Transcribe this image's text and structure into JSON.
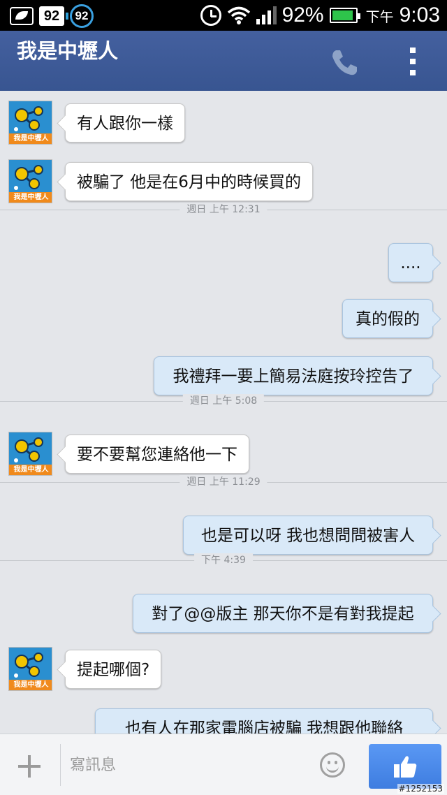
{
  "status_bar": {
    "notif_badge": "92",
    "circle_badge": "92",
    "battery_percent": "92%",
    "battery_level": 0.92,
    "ampm": "下午",
    "time": "9:03",
    "icons": [
      "leaf-notification-icon",
      "alarm-icon",
      "wifi-icon",
      "signal-icon",
      "battery-icon"
    ]
  },
  "header": {
    "title": "我是中壢人",
    "icons": [
      "phone-icon",
      "overflow-menu-icon"
    ],
    "color": "#3b5998"
  },
  "avatar_brand": "我是中壢人",
  "messages": [
    {
      "side": "in",
      "text": "有人跟你一樣"
    },
    {
      "side": "in",
      "text": "被騙了  他是在6月中的時候買的"
    },
    {
      "side": "divider",
      "text": "週日 上午 12:31"
    },
    {
      "side": "out",
      "text": "...."
    },
    {
      "side": "out",
      "text": "真的假的"
    },
    {
      "side": "out",
      "text": "我禮拜一要上簡易法庭按玲控告了"
    },
    {
      "side": "divider",
      "text": "週日 上午 5:08"
    },
    {
      "side": "in",
      "text": "要不要幫您連絡他一下"
    },
    {
      "side": "divider",
      "text": "週日 上午 11:29"
    },
    {
      "side": "out",
      "text": "也是可以呀 我也想問問被害人"
    },
    {
      "side": "divider",
      "text": "下午 4:39"
    },
    {
      "side": "out",
      "text": "對了@@版主 那天你不是有對我提起"
    },
    {
      "side": "in",
      "text": "提起哪個?"
    },
    {
      "side": "out",
      "text": "也有人在那家電腦店被騙  我想跟他聯絡"
    }
  ],
  "composer": {
    "placeholder": "寫訊息",
    "icons": [
      "plus-icon",
      "emoji-icon",
      "thumbs-up-icon"
    ],
    "like_color": "#4b8cf0"
  },
  "watermark": "#1252153"
}
